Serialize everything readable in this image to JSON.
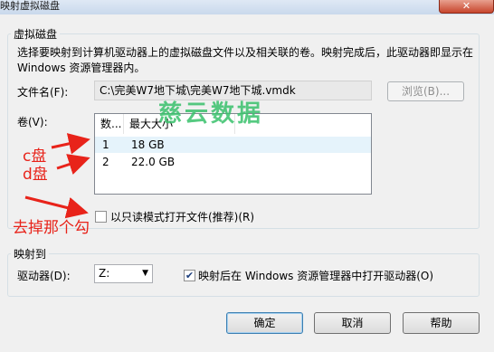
{
  "window": {
    "title": "映射虚拟磁盘",
    "close_glyph": "✕"
  },
  "virtual_disk": {
    "legend": "虚拟磁盘",
    "description": "选择要映射到计算机驱动器上的虚拟磁盘文件以及相关联的卷。映射完成后，此驱动器即显示在 Windows 资源管理器内。",
    "file_label": "文件名(F):",
    "file_value": "C:\\完美W7地下城\\完美W7地下城.vmdk",
    "browse_label": "浏览(B)...",
    "volume_label": "卷(V):",
    "columns": [
      "数...",
      "最大大小"
    ],
    "volumes": [
      {
        "num": "1",
        "size": "18 GB"
      },
      {
        "num": "2",
        "size": "22.0 GB"
      }
    ],
    "readonly_label": "以只读模式打开文件(推荐)(R)",
    "readonly_checked": false
  },
  "mapping": {
    "legend": "映射到",
    "drive_label": "驱动器(D):",
    "drive_value": "Z:",
    "open_explorer_label": "映射后在 Windows 资源管理器中打开驱动器(O)",
    "open_explorer_checked": true,
    "check_glyph": "✔"
  },
  "buttons": {
    "ok": "确定",
    "cancel": "取消",
    "help": "帮助"
  },
  "annotations": {
    "c_drive": "c盘",
    "d_drive": "d盘",
    "uncheck_note": "去掉那个勾",
    "accent": "#e8231a"
  },
  "watermark": "慈云数据"
}
